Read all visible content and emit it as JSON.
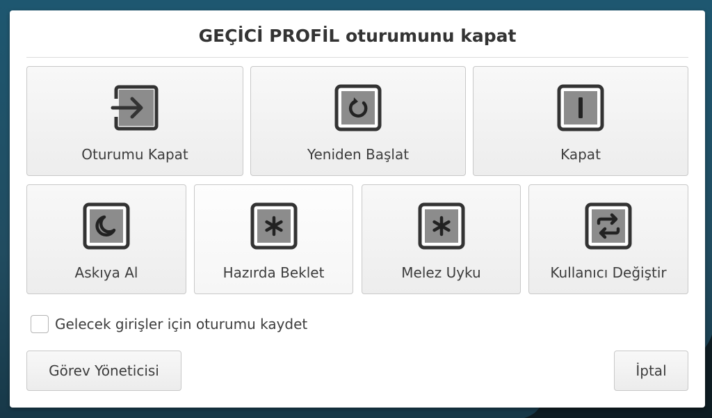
{
  "dialog": {
    "title": "GEÇİCİ PROFİL oturumunu kapat",
    "actions": [
      {
        "label": "Oturumu Kapat",
        "icon": "logout-icon"
      },
      {
        "label": "Yeniden Başlat",
        "icon": "restart-icon"
      },
      {
        "label": "Kapat",
        "icon": "power-icon"
      },
      {
        "label": "Askıya Al",
        "icon": "moon-icon"
      },
      {
        "label": "Hazırda Beklet",
        "icon": "asterisk-icon"
      },
      {
        "label": "Melez Uyku",
        "icon": "asterisk-icon"
      },
      {
        "label": "Kullanıcı Değiştir",
        "icon": "switch-user-icon"
      }
    ],
    "save_session_label": "Gelecek girişler için oturumu kaydet",
    "save_session_checked": false,
    "task_manager_label": "Görev Yöneticisi",
    "cancel_label": "İptal"
  },
  "colors": {
    "icon_frame": "#333333",
    "icon_fill": "#8c8c8c",
    "desktop": "#1f4f63"
  }
}
